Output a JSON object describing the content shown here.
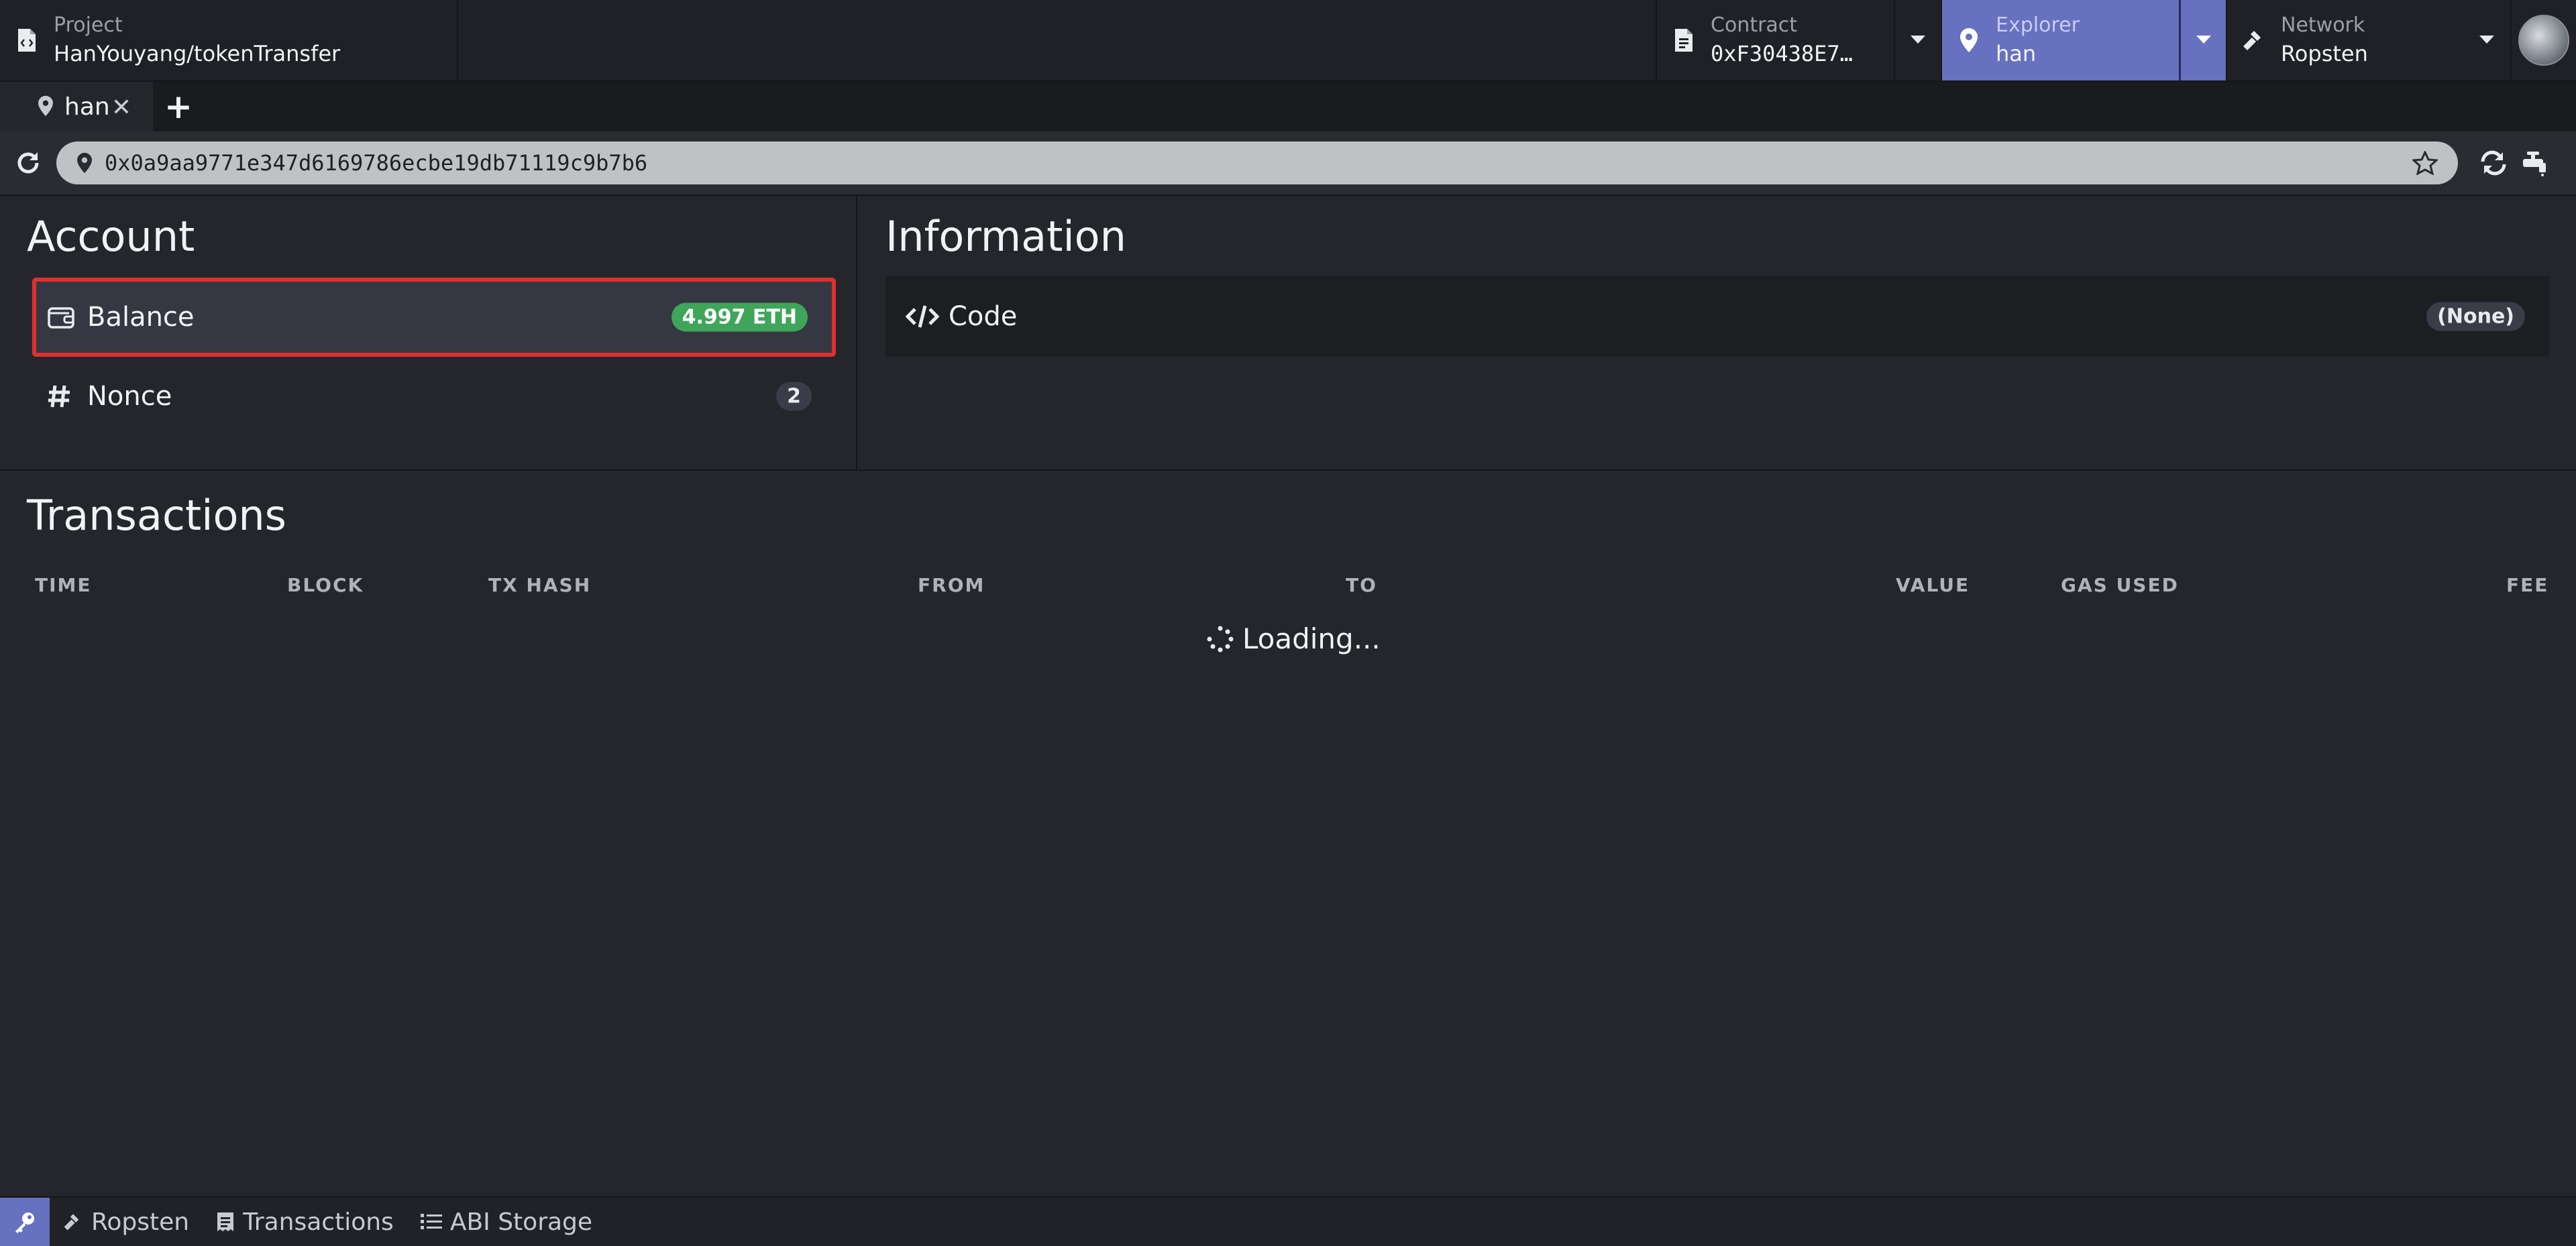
{
  "navbar": {
    "project": {
      "label": "Project",
      "value": "HanYouyang/tokenTransfer",
      "icon": "file-code-icon"
    },
    "contract": {
      "label": "Contract",
      "value": "0xF30438E7…",
      "icon": "file-contract-icon"
    },
    "explorer": {
      "label": "Explorer",
      "value": "han",
      "icon": "map-marker-icon"
    },
    "network": {
      "label": "Network",
      "value": "Ropsten",
      "icon": "hammer-icon"
    }
  },
  "tabs": [
    {
      "label": "han",
      "icon": "map-marker-icon",
      "close": "✕"
    }
  ],
  "tab_add": "+",
  "address": {
    "value": "0x0a9aa9771e347d6169786ecbe19db71119c9b7b6"
  },
  "account": {
    "title": "Account",
    "balance": {
      "label": "Balance",
      "value": "4.997 ETH",
      "icon": "wallet-icon"
    },
    "nonce": {
      "label": "Nonce",
      "value": "2",
      "icon": "hashtag-icon"
    }
  },
  "information": {
    "title": "Information",
    "code": {
      "label": "Code",
      "value": "(None)",
      "icon": "code-icon"
    }
  },
  "transactions": {
    "title": "Transactions",
    "columns": [
      "TIME",
      "BLOCK",
      "TX HASH",
      "FROM",
      "TO",
      "VALUE",
      "GAS USED",
      "FEE"
    ],
    "loading": "Loading..."
  },
  "statusbar": {
    "items": [
      {
        "label": "Ropsten",
        "icon": "hammer-icon"
      },
      {
        "label": "Transactions",
        "icon": "receipt-icon"
      },
      {
        "label": "ABI Storage",
        "icon": "list-icon"
      }
    ]
  },
  "colors": {
    "accent": "#6671bf",
    "success": "#3fa55a",
    "highlight": "#e02f2f",
    "background": "#25262c"
  }
}
